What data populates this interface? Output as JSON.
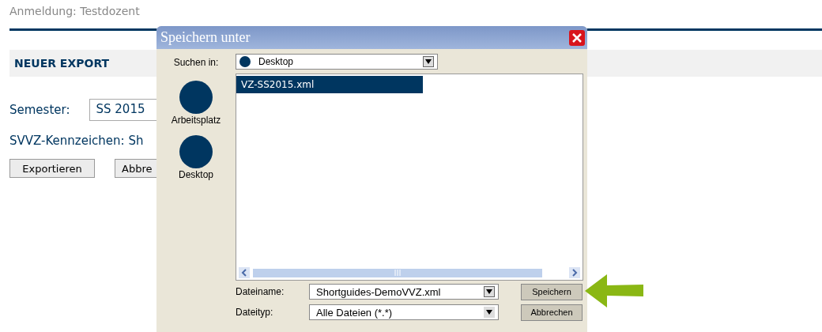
{
  "page": {
    "login": "Anmeldung: Testdozent",
    "section_title": "NEUER EXPORT",
    "semester_label": "Semester:",
    "semester_value": "SS 2015",
    "svvz_text": "SVVZ-Kennzeichen: Sh",
    "buttons": [
      "Exportieren",
      "Abbre"
    ]
  },
  "dialog": {
    "title": "Speichern unter",
    "look_in_label": "Suchen in:",
    "look_in_value": "Desktop",
    "places": [
      {
        "label": "Arbeitsplatz"
      },
      {
        "label": "Desktop"
      }
    ],
    "files": [
      {
        "name": "VZ-SS2015.xml",
        "selected": true
      }
    ],
    "filename_label": "Dateiname:",
    "filename_value": "Shortguides-DemoVVZ.xml",
    "filetype_label": "Dateityp:",
    "filetype_value": "Alle Dateien (*.*)",
    "save_button": "Speichern",
    "cancel_button": "Abbrechen"
  }
}
